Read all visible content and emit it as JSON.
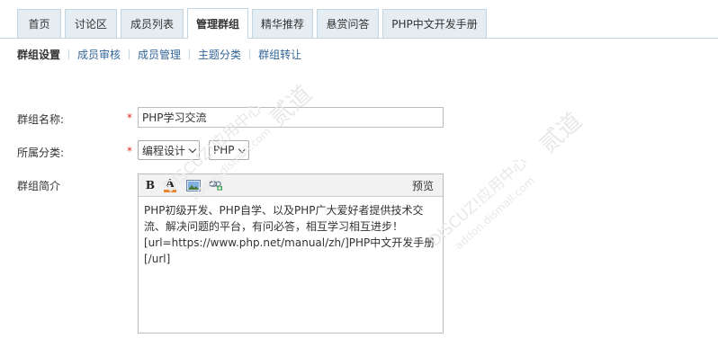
{
  "tabs": [
    {
      "label": "首页",
      "active": false
    },
    {
      "label": "讨论区",
      "active": false
    },
    {
      "label": "成员列表",
      "active": false
    },
    {
      "label": "管理群组",
      "active": true
    },
    {
      "label": "精华推荐",
      "active": false
    },
    {
      "label": "悬赏问答",
      "active": false
    },
    {
      "label": "PHP中文开发手册",
      "active": false
    }
  ],
  "subnav": [
    {
      "label": "群组设置",
      "current": true
    },
    {
      "label": "成员审核",
      "current": false
    },
    {
      "label": "成员管理",
      "current": false
    },
    {
      "label": "主题分类",
      "current": false
    },
    {
      "label": "群组转让",
      "current": false
    }
  ],
  "form": {
    "name_label": "群组名称:",
    "required_mark": "*",
    "name_value": "PHP学习交流",
    "category_label": "所属分类:",
    "category_primary": "编程设计",
    "category_secondary": "PHP",
    "intro_label": "群组简介"
  },
  "editor": {
    "bold_label": "B",
    "color_label": "A",
    "preview_label": "预览",
    "content": "PHP初级开发、PHP自学、以及PHP广大爱好者提供技术交流、解决问题的平台，有问必答，相互学习相互进步！\n[url=https://www.php.net/manual/zh/]PHP中文开发手册[/url]"
  },
  "icons": {
    "bold": "bold-icon",
    "color": "font-color-icon",
    "image": "image-icon",
    "link": "link-icon"
  },
  "watermark": {
    "brand": "DISCUZ!应用中心",
    "domain": "addon.dismall.com",
    "mark": "贰道"
  },
  "colors": {
    "tab_bg": "#e5edf2",
    "tab_border": "#c2d5e3",
    "link": "#336699",
    "required": "#e42a1d"
  }
}
